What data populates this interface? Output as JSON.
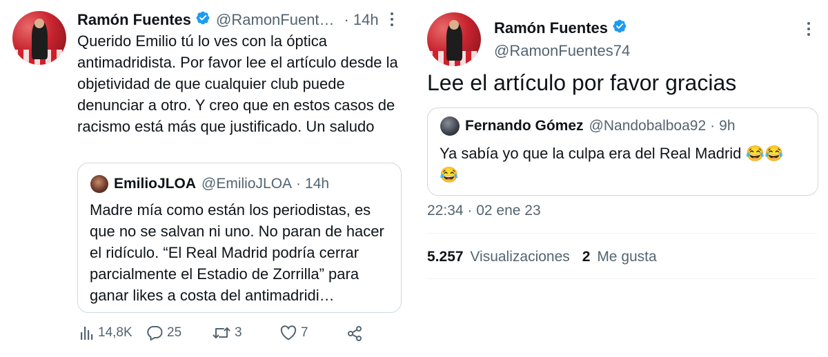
{
  "left_tweet": {
    "author_name": "Ramón Fuentes",
    "handle": "@RamonFuent…",
    "separator": "·",
    "time": "14h",
    "text": "Querido Emilio tú lo ves con la óptica antimadridista. Por favor lee el artículo desde la objetividad de que cualquier club puede denunciar a otro. Y creo que en estos casos de racismo está más que justificado. Un saludo",
    "quoted": {
      "author_name": "EmilioJLOA",
      "handle": "@EmilioJLOA",
      "separator": "·",
      "time": "14h",
      "text": "Madre mía como están los periodistas, es que no se salvan ni uno. No paran de hacer el ridículo. “El Real Madrid podría cerrar parcialmente el Estadio de Zorrilla” para ganar likes a costa del antimadridi…"
    },
    "actions": {
      "views": "14,8K",
      "replies": "25",
      "retweets": "3",
      "likes": "7"
    }
  },
  "right_tweet": {
    "author_name": "Ramón Fuentes",
    "handle": "@RamonFuentes74",
    "text": "Lee el artículo por favor gracias",
    "quoted": {
      "author_name": "Fernando Gómez",
      "handle": "@Nandobalboa92",
      "separator": "·",
      "time": "9h",
      "text": "Ya sabía yo que la culpa era del Real Madrid",
      "emoji_1": "😂",
      "emoji_2": "😂",
      "emoji_3": "😂"
    },
    "timestamp": "22:34 · 02 ene 23",
    "stats": {
      "views_count": "5.257",
      "views_label": "Visualizaciones",
      "likes_count": "2",
      "likes_label": "Me gusta"
    }
  },
  "colors": {
    "verified_blue": "#1d9bf0",
    "muted_text": "#536471",
    "border": "#cfd9de"
  }
}
